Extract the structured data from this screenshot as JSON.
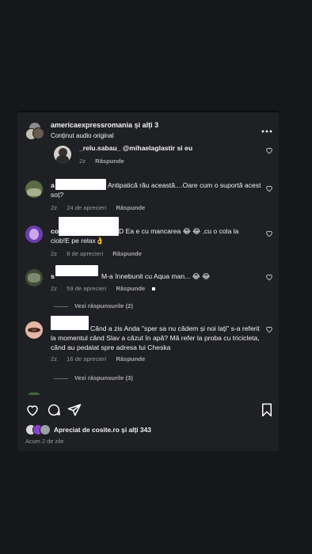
{
  "header": {
    "title": "americaexpressromania și alți 3",
    "subtitle": "Conținut audio original"
  },
  "comments": [
    {
      "partial_text": "_relu.sabau_ @mihaelaglastir si eu",
      "time": "2z",
      "reply_label": "Răspunde"
    },
    {
      "prefix": "a",
      "text": "Antipatică rău această....Oare cum o suportă acest soț?",
      "time": "2z",
      "date": "24 de aprecieri",
      "reply_label": "Răspunde"
    },
    {
      "prefix": "co",
      "text_first": "D Ea e cu mancarea 😂 😂 ,cu o cola la",
      "text_second": "ciob!E pe relax👌",
      "time": "2z",
      "date": "8 de aprecieri",
      "reply_label": "Răspunde"
    },
    {
      "prefix": "s",
      "text": "M-a înnebunit cu Aqua man... 😂 😂",
      "time": "2z",
      "date": "59 de aprecieri",
      "reply_label": "Răspunde",
      "view_replies": "Vezi răspunsurile (2)"
    },
    {
      "prefix": "",
      "text": "Când a zis Anda \"sper sa nu cădem și noi lați\" s-a referit la momentul când Slav a căzut în apă? Mă refer la proba cu tricicleta, când au pedalat spre adresa lui Cheska",
      "time": "2z",
      "date": "16 de aprecieri",
      "reply_label": "Răspunde",
      "view_replies": "Vezi răspunsurile (3)"
    }
  ],
  "footer": {
    "liked_by": "Apreciat de cosite.ro și alți 343",
    "age": "Acum 2 de zile"
  },
  "icons": [
    "more-icon",
    "heart-icon",
    "comment-icon",
    "share-icon",
    "bookmark-icon"
  ]
}
